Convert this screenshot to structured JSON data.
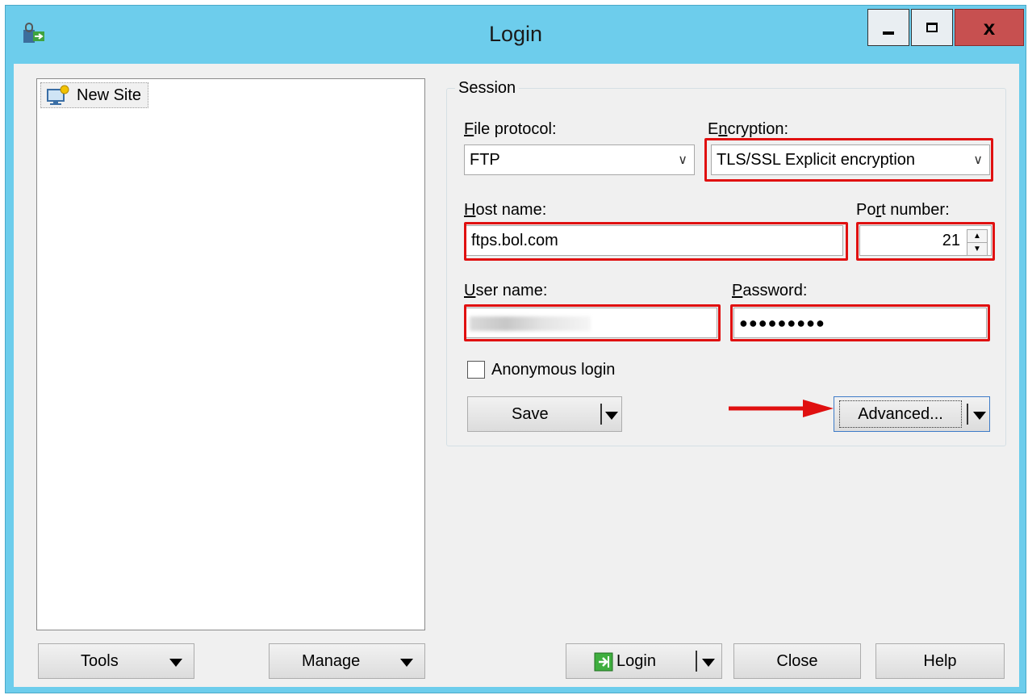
{
  "window": {
    "title": "Login",
    "accent": "#6dcdec",
    "close_glyph": "x"
  },
  "site_tree": {
    "items": [
      {
        "label": "New Site",
        "icon": "monitor-star-icon"
      }
    ]
  },
  "session": {
    "group_label": "Session",
    "file_protocol": {
      "label_first": "F",
      "label_rest": "ile protocol:",
      "value": "FTP"
    },
    "encryption": {
      "label_pre": "E",
      "label_ul": "n",
      "label_rest": "cryption:",
      "value": "TLS/SSL Explicit encryption"
    },
    "host_name": {
      "label_first": "H",
      "label_rest": "ost name:",
      "value": "ftps.bol.com"
    },
    "port_number": {
      "label_pre": "Po",
      "label_ul": "r",
      "label_rest": "t number:",
      "value": "21"
    },
    "user_name": {
      "label_first": "U",
      "label_rest": "ser name:",
      "value_state": "blurred"
    },
    "password": {
      "label_first": "P",
      "label_rest": "assword:",
      "value": "●●●●●●●●●"
    },
    "anonymous_login": {
      "label": "Anonymous login",
      "checked": false
    },
    "save_button": "Save",
    "advanced_button": "Advanced..."
  },
  "footer": {
    "tools_button": "Tools",
    "manage_button": "Manage",
    "login_button": "Login",
    "close_button": "Close",
    "help_button": "Help"
  },
  "highlight_color": "#e01010"
}
